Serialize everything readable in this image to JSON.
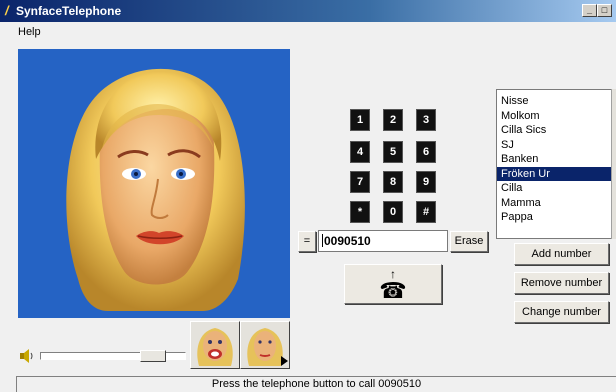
{
  "window": {
    "title": "SynfaceTelephone",
    "minimize_glyph": "_",
    "maximize_glyph": "□"
  },
  "menu": {
    "help": "Help"
  },
  "keypad": {
    "keys": [
      "1",
      "2",
      "3",
      "4",
      "5",
      "6",
      "7",
      "8",
      "9",
      "*",
      "0",
      "#"
    ]
  },
  "number_entry": {
    "equals_label": "=",
    "value": "0090510",
    "erase_label": "Erase"
  },
  "call_button": {
    "icon": "telephone-icon",
    "glyph": "☎",
    "arrow": "↑"
  },
  "contacts": {
    "items": [
      "Nisse",
      "Molkom",
      "Cilla Sics",
      "SJ",
      "Banken",
      "Fröken Ur",
      "Cilla",
      "Mamma",
      "Pappa"
    ],
    "selected": "Fröken Ur"
  },
  "actions": {
    "add": "Add number",
    "remove": "Remove number",
    "change": "Change number"
  },
  "volume": {
    "icon": "speaker-icon",
    "level": 0.72
  },
  "status": {
    "text": "Press the telephone button to call 0090510"
  },
  "colors": {
    "face_bg": "#2563c4",
    "selection": "#0a246a",
    "titlebar": "#0a246a"
  }
}
